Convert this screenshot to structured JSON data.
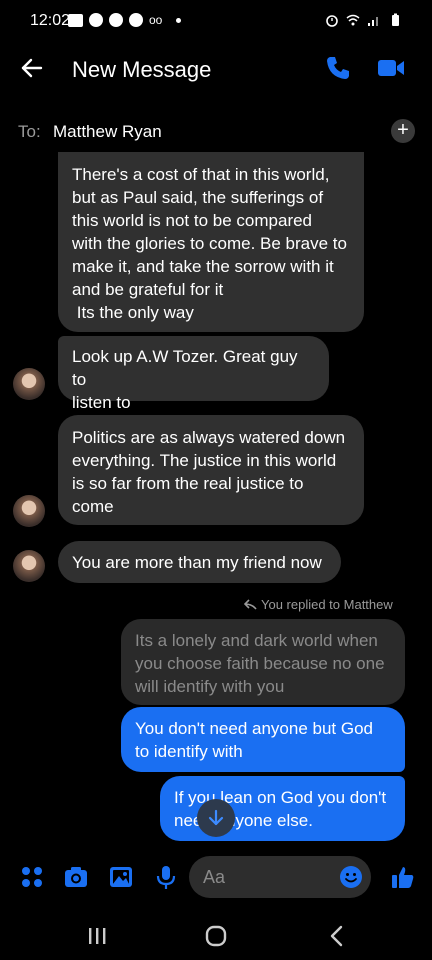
{
  "status_bar": {
    "time": "12:02",
    "voicemail": "oo"
  },
  "header": {
    "title": "New Message"
  },
  "to_row": {
    "label": "To:",
    "recipient": "Matthew Ryan"
  },
  "messages": {
    "m1": {
      "lines": [
        "There's a cost of that in this world,",
        "but as Paul said, the sufferings of",
        "this world is not to be compared",
        "with the glories to come. Be brave to",
        "make it, and take the sorrow with it",
        "and be grateful for it",
        " Its the only way"
      ]
    },
    "m2": {
      "lines": [
        "Look up A.W Tozer. Great guy to",
        "listen to"
      ]
    },
    "m3": {
      "lines": [
        "Politics are as always watered down",
        "everything. The justice in this world",
        "is so far from the real justice to",
        "come"
      ]
    },
    "m4": {
      "lines": [
        "You are more than my friend now"
      ]
    },
    "reply_note": "You replied to Matthew",
    "m5": {
      "lines": [
        "Its a lonely and dark world when",
        "you choose faith because no one",
        "will identify with you"
      ]
    },
    "m6": {
      "lines": [
        "You don't need anyone but God",
        "to identify with"
      ]
    },
    "m7": {
      "lines": [
        "If you lean on God you don't",
        "need anyone else."
      ]
    }
  },
  "composer": {
    "placeholder": "Aa"
  },
  "colors": {
    "accent": "#1a6ff2",
    "incoming_bubble": "#303030",
    "background": "#000000"
  }
}
